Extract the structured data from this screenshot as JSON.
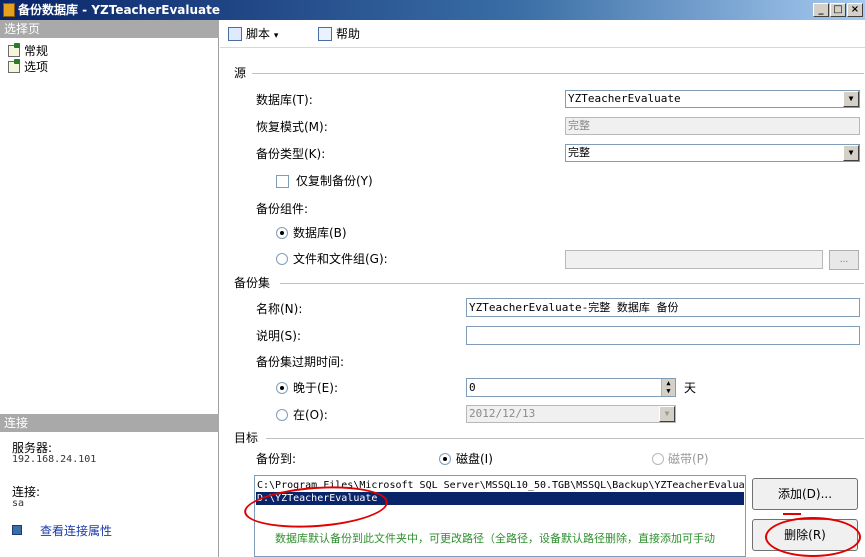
{
  "window": {
    "title": "备份数据库 - YZTeacherEvaluate"
  },
  "left": {
    "select_page_header": "选择页",
    "pages": [
      "常规",
      "选项"
    ],
    "connection_header": "连接",
    "server_label": "服务器:",
    "server_value": "192.168.24.101",
    "connection_label": "连接:",
    "connection_value": "sa",
    "view_link": "查看连接属性"
  },
  "toolbar": {
    "script_label": "脚本",
    "help_label": "帮助"
  },
  "source": {
    "section_label": "源",
    "database_label": "数据库(T):",
    "database_value": "YZTeacherEvaluate",
    "recovery_label": "恢复模式(M):",
    "recovery_value": "完整",
    "backup_type_label": "备份类型(K):",
    "backup_type_value": "完整",
    "copy_only_label": "仅复制备份(Y)",
    "component_label": "备份组件:",
    "component_database": "数据库(B)",
    "component_files": "文件和文件组(G):",
    "browse_label": "..."
  },
  "backup_set": {
    "section_label": "备份集",
    "name_label": "名称(N):",
    "name_value": "YZTeacherEvaluate-完整 数据库 备份",
    "desc_label": "说明(S):",
    "desc_value": "",
    "expire_label": "备份集过期时间:",
    "after_label": "晚于(E):",
    "after_value": "0",
    "days_label": "天",
    "on_label": "在(O):",
    "on_value": "2012/12/13"
  },
  "destination": {
    "section_label": "目标",
    "backup_to_label": "备份到:",
    "disk_label": "磁盘(I)",
    "tape_label": "磁带(P)",
    "items": [
      "C:\\Program Files\\Microsoft SQL Server\\MSSQL10_50.TGB\\MSSQL\\Backup\\YZTeacherEvaluate",
      "D:\\YZTeacherEvaluate"
    ],
    "hint": "数据库默认备份到此文件夹中，可更改路径（全路径，设备默认路径删除，直接添加可手动",
    "add_label": "添加(D)...",
    "remove_label": "删除(R)"
  },
  "annotation_color": "#e00000"
}
